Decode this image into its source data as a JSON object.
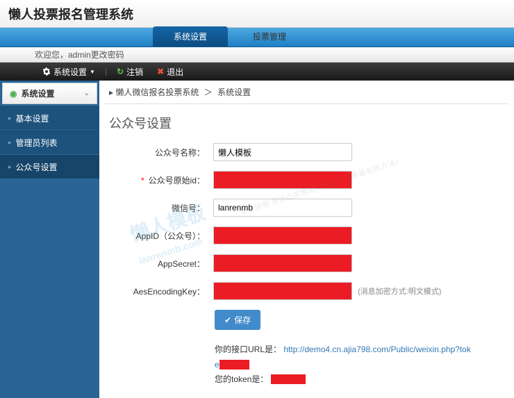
{
  "header": {
    "title": "懒人投票报名管理系统"
  },
  "tabs": [
    {
      "label": "系统设置",
      "active": true
    },
    {
      "label": "投票管理",
      "active": false
    }
  ],
  "welcome": "欢迎您，admin更改密码",
  "toolbar": {
    "settings": "系统设置",
    "logout": "注销",
    "exit": "退出"
  },
  "sidebar": {
    "header": "系统设置",
    "items": [
      {
        "label": "基本设置"
      },
      {
        "label": "管理员列表"
      },
      {
        "label": "公众号设置"
      }
    ]
  },
  "breadcrumb": {
    "root": "懒人微信报名投票系统",
    "current": "系统设置"
  },
  "page": {
    "title": "公众号设置"
  },
  "form": {
    "fields": [
      {
        "label": "公众号名称：",
        "value": "懒人模板",
        "required": false
      },
      {
        "label": "公众号原始id：",
        "value": "",
        "required": true,
        "redacted": true
      },
      {
        "label": "微信号：",
        "value": "lanrenmb",
        "required": false
      },
      {
        "label": "AppID（公众号）：",
        "value": "",
        "required": false,
        "redacted": true
      },
      {
        "label": "AppSecret：",
        "value": "",
        "required": false,
        "redacted": true
      },
      {
        "label": "AesEncodingKey：",
        "value": "",
        "required": false,
        "redacted": true,
        "hint": "(消息加密方式:明文模式)"
      }
    ],
    "save_label": "保存"
  },
  "info": {
    "url_label": "你的接口URL是：",
    "url": "http://demo4.cn.ajia798.com/Public/weixin.php?toke",
    "token_label": "您的token是："
  },
  "watermark": {
    "main": "懒人模板",
    "url": "lanrenmb.com",
    "sub": "学会偷懒 并做出偷懒是提供工作效率最有效方法！"
  }
}
